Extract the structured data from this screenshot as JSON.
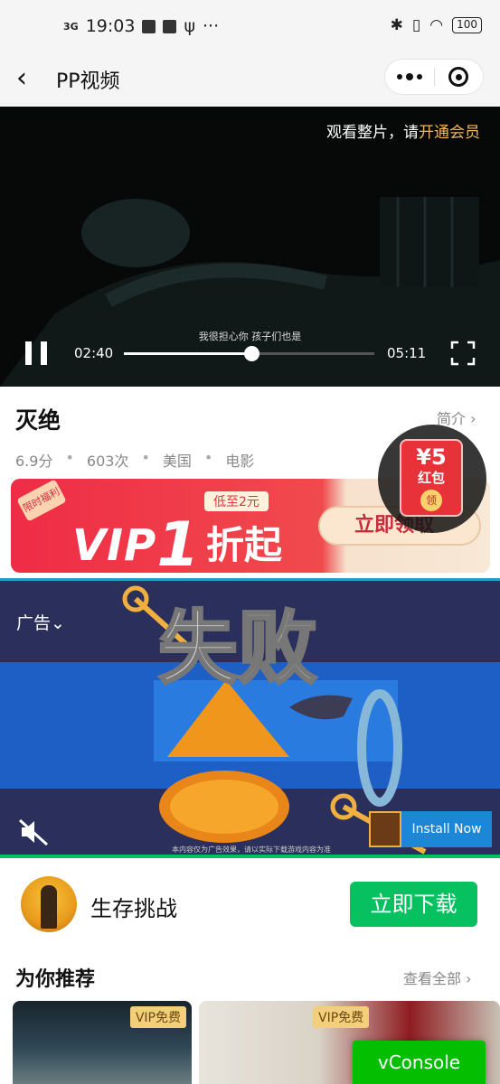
{
  "status_bar": {
    "network": "3G",
    "time": "19:03",
    "dots": "···",
    "battery": "100"
  },
  "nav": {
    "title": "PP视频",
    "back_icon": "chevron-left-icon",
    "more_icon": "more-dots-icon",
    "close_icon": "target-close-icon"
  },
  "video": {
    "vip_prompt": "观看整片，请",
    "vip_link": "开通会员",
    "subtitle": "我很担心你  孩子们也是",
    "current_time": "02:40",
    "total_time": "05:11",
    "progress": 0.51
  },
  "movie": {
    "title": "灭绝",
    "intro_label": "简介",
    "rating": "6.9分",
    "plays": "603次",
    "country": "美国",
    "category": "电影"
  },
  "red_packet": {
    "amount": "¥5",
    "label": "红包",
    "action": "领"
  },
  "vip_banner": {
    "tag": "限时福利",
    "vip_text": "VIP",
    "discount_number": "1",
    "pill": "低至2元",
    "discount_suffix": "折起",
    "button": "立即领取"
  },
  "ad": {
    "label": "广告",
    "install_label": "Install Now",
    "disclaimer": "本内容仅为广告效果，请以实际下载游戏内容为准",
    "accent_color": "#1c86d7"
  },
  "app_promo": {
    "name": "生存挑战",
    "download_label": "立即下载"
  },
  "recommend": {
    "title": "为你推荐",
    "see_all": "查看全部",
    "items": [
      {
        "badge": "VIP免费"
      },
      {
        "badge": "VIP免费"
      }
    ]
  },
  "vconsole": {
    "label": "vConsole"
  }
}
